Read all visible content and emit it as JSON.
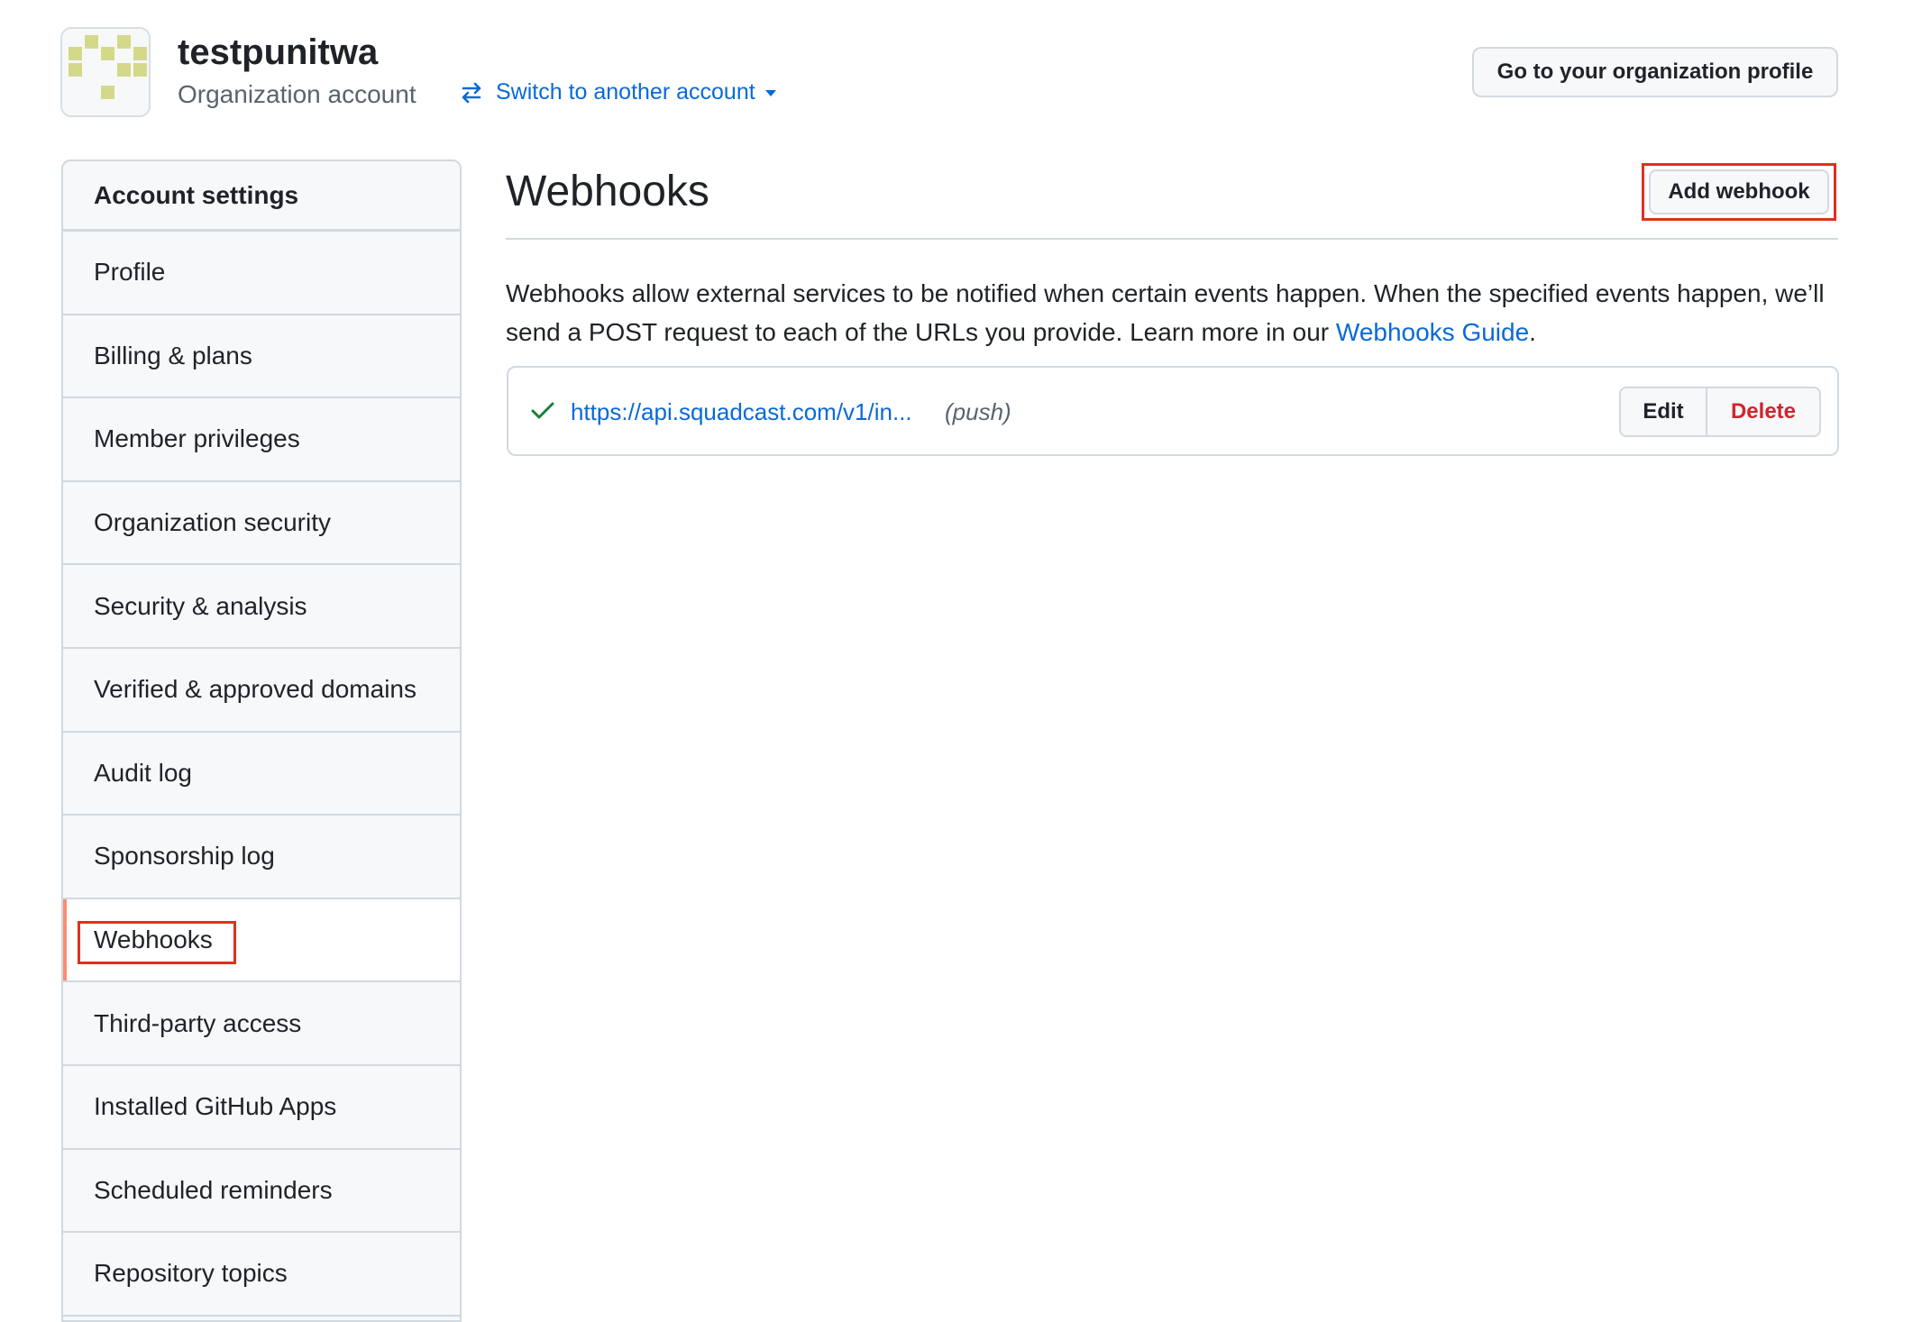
{
  "header": {
    "org_name": "testpunitwa",
    "org_type": "Organization account",
    "switch_account_label": "Switch to another account",
    "org_profile_button": "Go to your organization profile"
  },
  "sidebar": {
    "heading": "Account settings",
    "items": [
      {
        "label": "Profile"
      },
      {
        "label": "Billing & plans"
      },
      {
        "label": "Member privileges"
      },
      {
        "label": "Organization security"
      },
      {
        "label": "Security & analysis"
      },
      {
        "label": "Verified & approved domains"
      },
      {
        "label": "Audit log"
      },
      {
        "label": "Sponsorship log"
      },
      {
        "label": "Webhooks",
        "active": true
      },
      {
        "label": "Third-party access"
      },
      {
        "label": "Installed GitHub Apps"
      },
      {
        "label": "Scheduled reminders"
      },
      {
        "label": "Repository topics"
      }
    ]
  },
  "main": {
    "title": "Webhooks",
    "add_button": "Add webhook",
    "description_text": "Webhooks allow external services to be notified when certain events happen. When the specified events happen, we’ll send a POST request to each of the URLs you provide. Learn more in our ",
    "description_link": "Webhooks Guide",
    "description_end": ".",
    "webhooks": [
      {
        "status_icon": "check-icon",
        "url": "https://api.squadcast.com/v1/in...",
        "event": "(push)",
        "edit_label": "Edit",
        "delete_label": "Delete"
      }
    ]
  },
  "colors": {
    "link": "#0969da",
    "danger": "#d1242f",
    "success": "#1a7f37",
    "annotation_box": "#e0301e",
    "active_indicator": "#fd8c73",
    "identicon": "#d4d98a"
  }
}
